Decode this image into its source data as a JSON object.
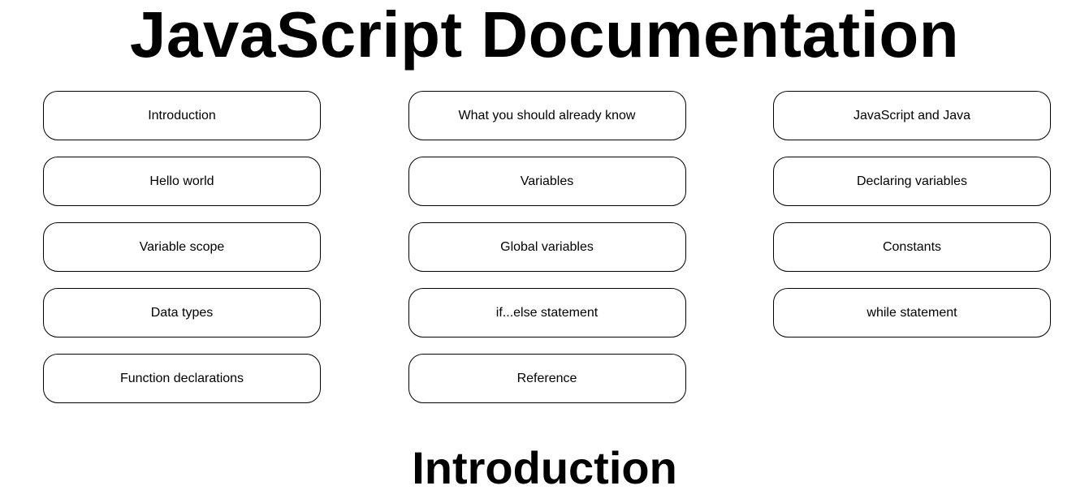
{
  "header": {
    "title": "JavaScript Documentation"
  },
  "nav": {
    "items": [
      {
        "label": "Introduction"
      },
      {
        "label": "What you should already know"
      },
      {
        "label": "JavaScript and Java"
      },
      {
        "label": "Hello world"
      },
      {
        "label": "Variables"
      },
      {
        "label": "Declaring variables"
      },
      {
        "label": "Variable scope"
      },
      {
        "label": "Global variables"
      },
      {
        "label": "Constants"
      },
      {
        "label": "Data types"
      },
      {
        "label": "if...else statement"
      },
      {
        "label": "while statement"
      },
      {
        "label": "Function declarations"
      },
      {
        "label": "Reference"
      }
    ]
  },
  "main": {
    "section_title": "Introduction"
  }
}
